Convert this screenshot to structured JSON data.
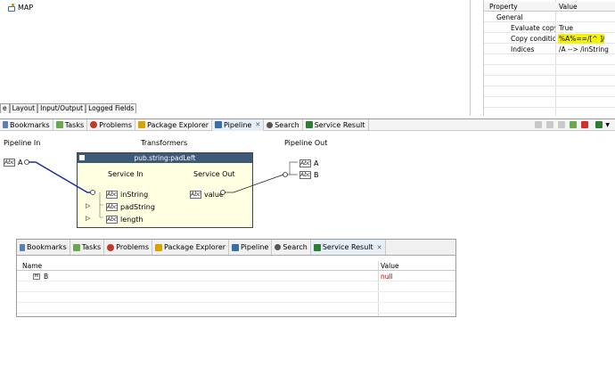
{
  "editor": {
    "map_label": "MAP"
  },
  "editor_tabs": [
    "e",
    "Layout",
    "Input/Output",
    "Logged Fields"
  ],
  "properties": {
    "headers": {
      "property": "Property",
      "value": "Value"
    },
    "group": "General",
    "rows": [
      {
        "name": "Evaluate copy c",
        "value": "True"
      },
      {
        "name": "Copy condition",
        "value": "%A%==/[^ ]/"
      },
      {
        "name": "Indices",
        "value": "/A --> /inString"
      }
    ]
  },
  "views_tabs": [
    {
      "label": "Bookmarks",
      "icon": "bookmarks-icon",
      "color": "#5a7fb5"
    },
    {
      "label": "Tasks",
      "icon": "tasks-icon",
      "color": "#6aa84f"
    },
    {
      "label": "Problems",
      "icon": "problems-icon",
      "color": "#c0392b"
    },
    {
      "label": "Package Explorer",
      "icon": "package-explorer-icon",
      "color": "#d8a300"
    },
    {
      "label": "Pipeline",
      "icon": "pipeline-icon",
      "color": "#3b6ea5",
      "active": true
    },
    {
      "label": "Search",
      "icon": "search-icon",
      "color": "#555555"
    },
    {
      "label": "Service Result",
      "icon": "service-result-icon",
      "color": "#2e7d32"
    }
  ],
  "pipeline": {
    "col_in": "Pipeline In",
    "col_transformers": "Transformers",
    "col_out": "Pipeline Out",
    "in_field": "A",
    "transformer": {
      "title": "pub.string:padLeft",
      "service_in": "Service In",
      "service_out": "Service Out",
      "inputs": [
        "inString",
        "padString",
        "length"
      ],
      "outputs": [
        "value"
      ]
    },
    "out_fields": [
      "A",
      "B"
    ],
    "string_icon_text": "Abc"
  },
  "service_result": {
    "tabs": [
      {
        "label": "Bookmarks",
        "color": "#5a7fb5"
      },
      {
        "label": "Tasks",
        "color": "#6aa84f"
      },
      {
        "label": "Problems",
        "color": "#c0392b"
      },
      {
        "label": "Package Explorer",
        "color": "#d8a300"
      },
      {
        "label": "Pipeline",
        "color": "#3b6ea5"
      },
      {
        "label": "Search",
        "color": "#555555"
      },
      {
        "label": "Service Result",
        "color": "#2e7d32",
        "active": true
      }
    ],
    "headers": {
      "name": "Name",
      "value": "Value"
    },
    "rows": [
      {
        "name": "B",
        "value": "null"
      }
    ],
    "null_color": "#cc0000"
  }
}
